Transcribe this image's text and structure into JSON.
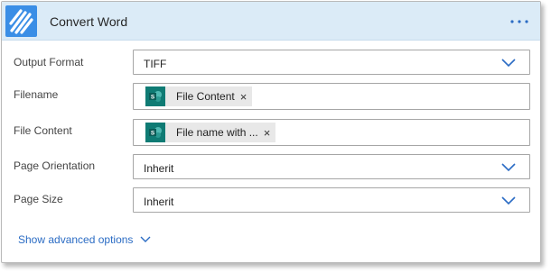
{
  "header": {
    "title": "Convert Word",
    "logo_icon": "striped-logo-icon",
    "more_icon": "ellipsis-icon",
    "accent": "#3a8ee6",
    "background": "#dbebf7"
  },
  "fields": {
    "output_format": {
      "label": "Output Format",
      "value": "TIFF"
    },
    "filename": {
      "label": "Filename",
      "token": "File Content",
      "token_icon": "sharepoint-icon"
    },
    "file_content": {
      "label": "File Content",
      "token": "File name with ...",
      "token_icon": "sharepoint-icon"
    },
    "page_orientation": {
      "label": "Page Orientation",
      "value": "Inherit"
    },
    "page_size": {
      "label": "Page Size",
      "value": "Inherit"
    }
  },
  "advanced": {
    "label": "Show advanced options"
  },
  "colors": {
    "link": "#2b6cc4",
    "token_icon_bg": "#0f7b74"
  }
}
